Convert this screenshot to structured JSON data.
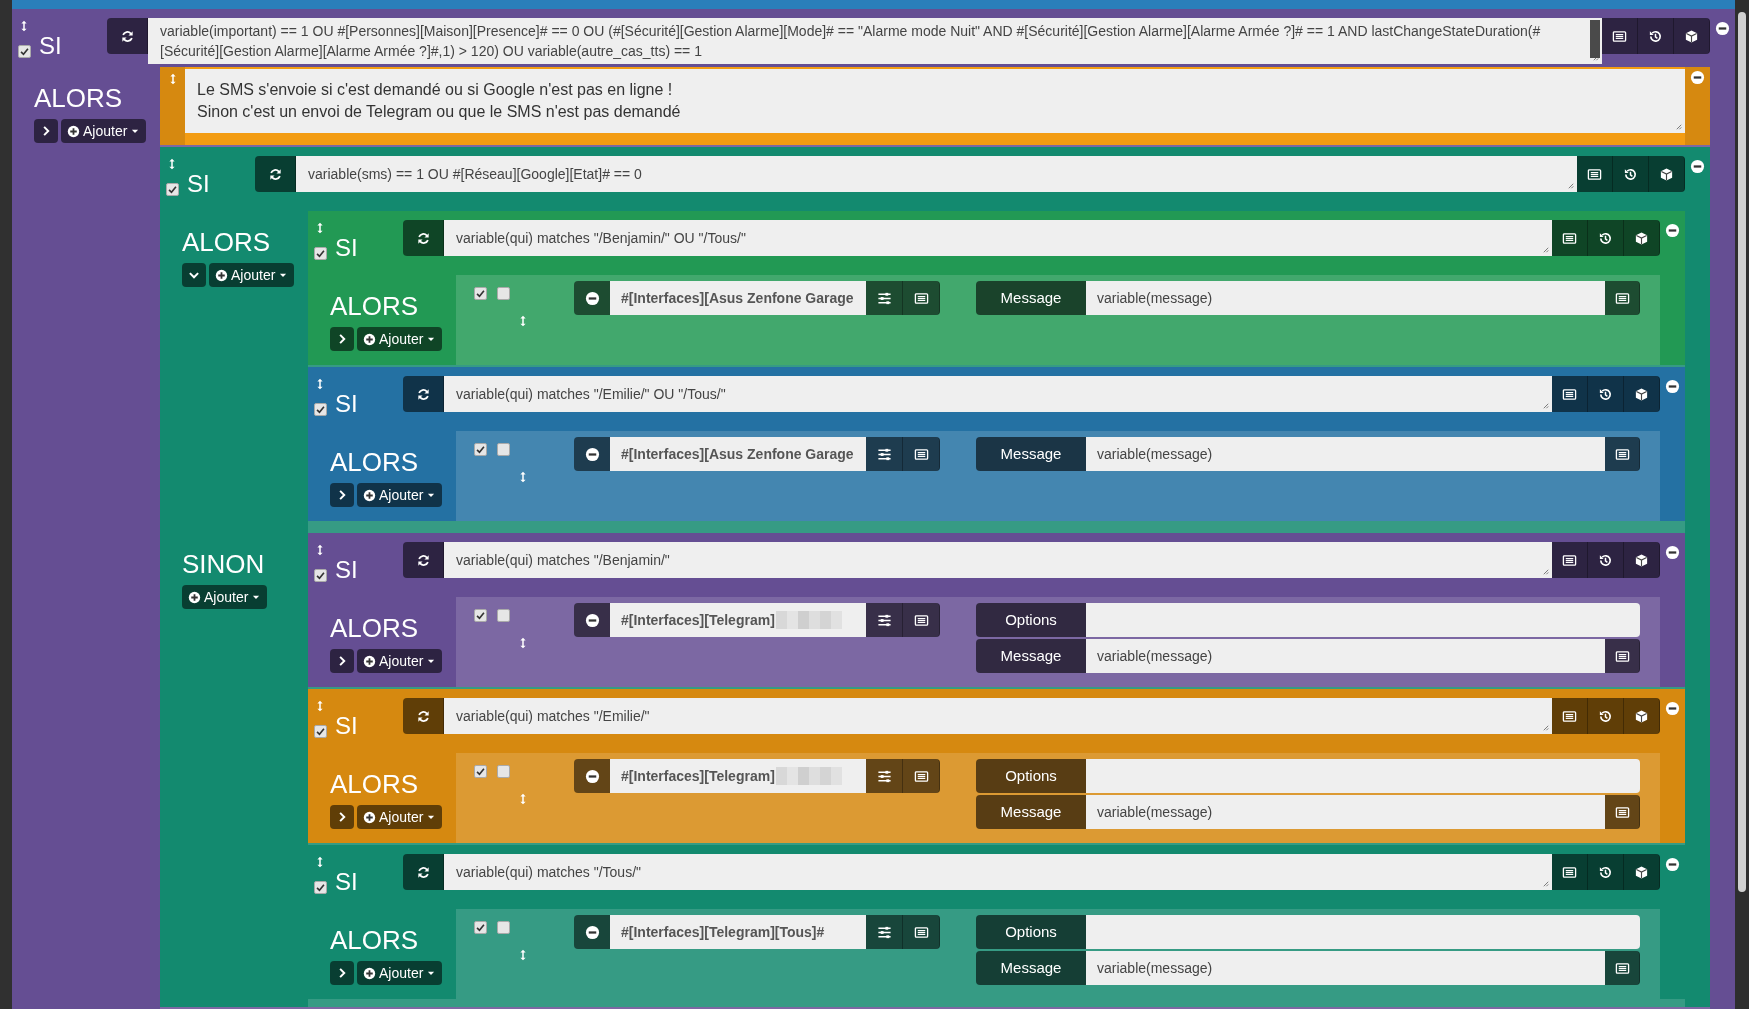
{
  "root": {
    "kind": "if",
    "keyword": "SI",
    "color": "#654e93",
    "enabled": true,
    "condition": "variable(important) == 1 OU #[Personnes][Maison][Presence]# == 0 OU (#[Sécurité][Gestion Alarme][Mode]# == \"Alarme mode Nuit\" AND #[Sécurité][Gestion Alarme][Alarme Armée ?]# == 1 AND lastChangeStateDuration(#[Sécurité][Gestion Alarme][Alarme Armée ?]#,1) > 120) OU variable(autre_cas_tts) == 1",
    "then_label": "ALORS",
    "then_expanded": false,
    "add_label": "Ajouter",
    "then": [
      {
        "kind": "comment",
        "lines": [
          "Le SMS s'envoie si c'est demandé ou si Google n'est pas en ligne !",
          "Sinon c'est un envoi de Telegram ou que le SMS n'est pas demandé"
        ]
      },
      {
        "kind": "if",
        "keyword": "SI",
        "color": "#138a6f",
        "enabled": true,
        "condition": "variable(sms) == 1 OU #[Réseau][Google][Etat]# == 0",
        "then_label": "ALORS",
        "then_expanded": true,
        "add_label": "Ajouter",
        "then": [
          {
            "kind": "if",
            "keyword": "SI",
            "color": "#229954",
            "enabled": true,
            "condition": "variable(qui) matches \"/Benjamin/\" OU \"/Tous/\"",
            "then_label": "ALORS",
            "then_expanded": false,
            "add_label": "Ajouter",
            "then": [
              {
                "kind": "action",
                "enabled": true,
                "parallel": false,
                "command": "#[Interfaces][Asus Zenfone Garage",
                "redacted": false,
                "options": [
                  {
                    "label": "Message",
                    "value": "variable(message)"
                  }
                ]
              }
            ]
          },
          {
            "kind": "if",
            "keyword": "SI",
            "color": "#2471a3",
            "enabled": true,
            "condition": "variable(qui) matches \"/Emilie/\" OU \"/Tous/\"",
            "then_label": "ALORS",
            "then_expanded": false,
            "add_label": "Ajouter",
            "then": [
              {
                "kind": "action",
                "enabled": true,
                "parallel": false,
                "command": "#[Interfaces][Asus Zenfone Garage",
                "redacted": false,
                "options": [
                  {
                    "label": "Message",
                    "value": "variable(message)"
                  }
                ]
              }
            ]
          }
        ],
        "else_label": "SINON",
        "else_add_label": "Ajouter",
        "else": [
          {
            "kind": "if",
            "keyword": "SI",
            "color": "#654e93",
            "enabled": true,
            "condition": "variable(qui) matches \"/Benjamin/\"",
            "then_label": "ALORS",
            "then_expanded": false,
            "add_label": "Ajouter",
            "then": [
              {
                "kind": "action",
                "enabled": true,
                "parallel": false,
                "command": "#[Interfaces][Telegram]",
                "redacted": true,
                "options": [
                  {
                    "label": "Options"
                  },
                  {
                    "label": "Message",
                    "value": "variable(message)"
                  }
                ]
              }
            ]
          },
          {
            "kind": "if",
            "keyword": "SI",
            "color": "#d68910",
            "enabled": true,
            "condition": "variable(qui) matches \"/Emilie/\"",
            "then_label": "ALORS",
            "then_expanded": false,
            "add_label": "Ajouter",
            "then": [
              {
                "kind": "action",
                "enabled": true,
                "parallel": false,
                "command": "#[Interfaces][Telegram]",
                "redacted": true,
                "options": [
                  {
                    "label": "Options"
                  },
                  {
                    "label": "Message",
                    "value": "variable(message)"
                  }
                ]
              }
            ]
          },
          {
            "kind": "if",
            "keyword": "SI",
            "color": "#138a6f",
            "enabled": true,
            "condition": "variable(qui) matches \"/Tous/\"",
            "then_label": "ALORS",
            "then_expanded": false,
            "add_label": "Ajouter",
            "then": [
              {
                "kind": "action",
                "enabled": true,
                "parallel": false,
                "command": "#[Interfaces][Telegram][Tous]#",
                "redacted": false,
                "options": [
                  {
                    "label": "Options"
                  },
                  {
                    "label": "Message",
                    "value": "variable(message)"
                  }
                ]
              }
            ]
          }
        ]
      }
    ]
  }
}
